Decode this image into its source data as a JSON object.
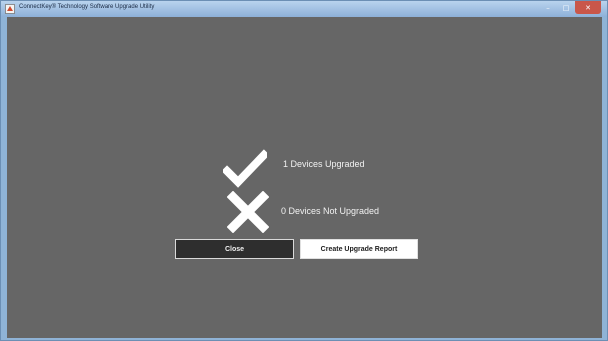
{
  "window": {
    "title": "ConnectKey® Technology Software Upgrade Utility",
    "minimize_label": "–",
    "maximize_label": "□",
    "close_label": "✕"
  },
  "summary": {
    "upgraded_text": "1 Devices Upgraded",
    "not_upgraded_text": "0 Devices Not Upgraded",
    "upgraded_icon": "checkmark-icon",
    "not_upgraded_icon": "x-mark-icon"
  },
  "buttons": {
    "close_label": "Close",
    "report_label": "Create Upgrade Report"
  },
  "colors": {
    "background": "#666666",
    "icon": "#ffffff",
    "close_button": "#2e2e2e",
    "report_button": "#ffffff"
  }
}
